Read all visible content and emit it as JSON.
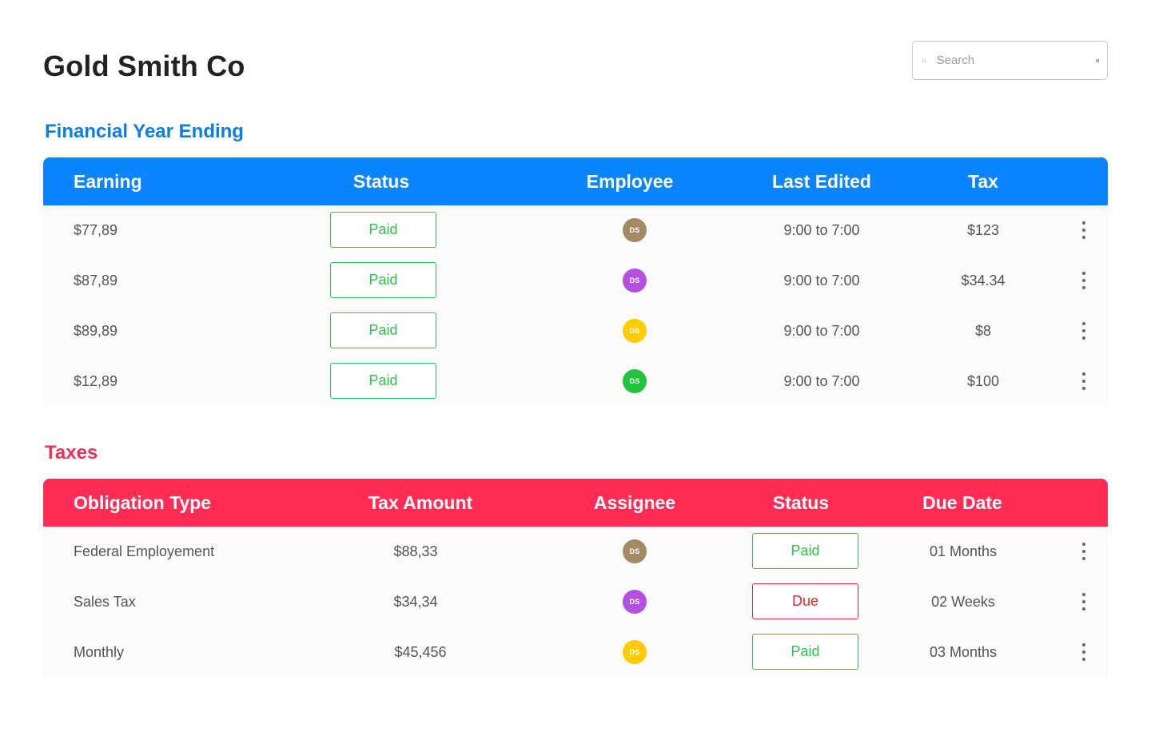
{
  "header": {
    "title": "Gold Smith Co",
    "search_placeholder": "Search"
  },
  "financial": {
    "title": "Financial Year Ending",
    "columns": [
      "Earning",
      "Status",
      "Employee",
      "Last Edited",
      "Tax"
    ],
    "rows": [
      {
        "earning": "$77,89",
        "status": "Paid",
        "employee": "DS",
        "avatar_color": "#a48a62",
        "last_edited": "9:00 to 7:00",
        "tax": "$123"
      },
      {
        "earning": "$87,89",
        "status": "Paid",
        "employee": "DS",
        "avatar_color": "#b44fe0",
        "last_edited": "9:00 to 7:00",
        "tax": "$34.34"
      },
      {
        "earning": "$89,89",
        "status": "Paid",
        "employee": "DS",
        "avatar_color": "#ffcc00",
        "last_edited": "9:00 to 7:00",
        "tax": "$8"
      },
      {
        "earning": "$12,89",
        "status": "Paid",
        "employee": "DS",
        "avatar_color": "#24c33f",
        "last_edited": "9:00 to 7:00",
        "tax": "$100"
      }
    ]
  },
  "taxes": {
    "title": "Taxes",
    "columns": [
      "Obligation Type",
      "Tax Amount",
      "Assignee",
      "Status",
      "Due Date"
    ],
    "rows": [
      {
        "type": "Federal Employement",
        "amount": "$88,33",
        "assignee": "DS",
        "avatar_color": "#a48a62",
        "status": "Paid",
        "status_kind": "paid",
        "due": "01 Months"
      },
      {
        "type": "Sales Tax",
        "amount": "$34,34",
        "assignee": "DS",
        "avatar_color": "#b44fe0",
        "status": "Due",
        "status_kind": "due",
        "due": "02 Weeks"
      },
      {
        "type": "Monthly",
        "amount": "$45,456",
        "assignee": "DS",
        "avatar_color": "#ffcc00",
        "status": "Paid",
        "status_kind": "paid",
        "due": "03 Months"
      }
    ]
  },
  "colors": {
    "financial_accent": "#0a84ff",
    "taxes_accent": "#ff2d55",
    "paid": "#2fc14b",
    "due": "#e3282e"
  },
  "icons": {
    "search": "search-icon",
    "clear": "clear-icon",
    "row_menu": "more-vertical-icon"
  }
}
